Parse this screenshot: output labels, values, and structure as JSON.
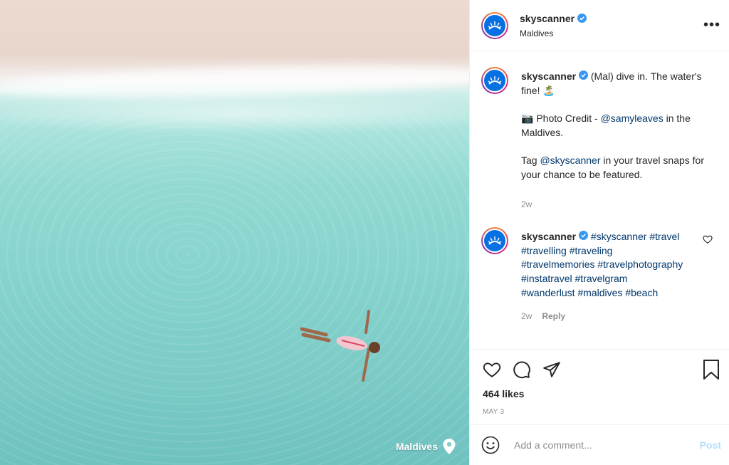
{
  "photo": {
    "location_label": "Maldives"
  },
  "header": {
    "username": "skyscanner",
    "location": "Maldives",
    "more_label": "•••"
  },
  "caption": {
    "username": "skyscanner",
    "text1": "(Mal) dive in. The water's fine! 🏝️",
    "credit_prefix": "📷 Photo Credit - ",
    "credit_handle": "@samyleaves",
    "credit_suffix": " in the Maldives.",
    "tag_prefix": "Tag ",
    "tag_handle": "@skyscanner",
    "tag_suffix": " in your travel snaps for your chance to be featured.",
    "time": "2w"
  },
  "comment": {
    "username": "skyscanner",
    "hashtags": [
      "#skyscanner",
      "#travel",
      "#travelling",
      "#traveling",
      "#travelmemories",
      "#travelphotography",
      "#instatravel",
      "#travelgram",
      "#wanderlust",
      "#maldives",
      "#beach"
    ],
    "time": "2w",
    "reply_label": "Reply"
  },
  "stats": {
    "likes": "464 likes",
    "date": "MAY 3"
  },
  "add_comment": {
    "placeholder": "Add a comment...",
    "post_label": "Post"
  },
  "colors": {
    "brand": "#0770e3",
    "verified": "#3897f0",
    "link": "#00376b",
    "muted": "#8e8e8e"
  }
}
